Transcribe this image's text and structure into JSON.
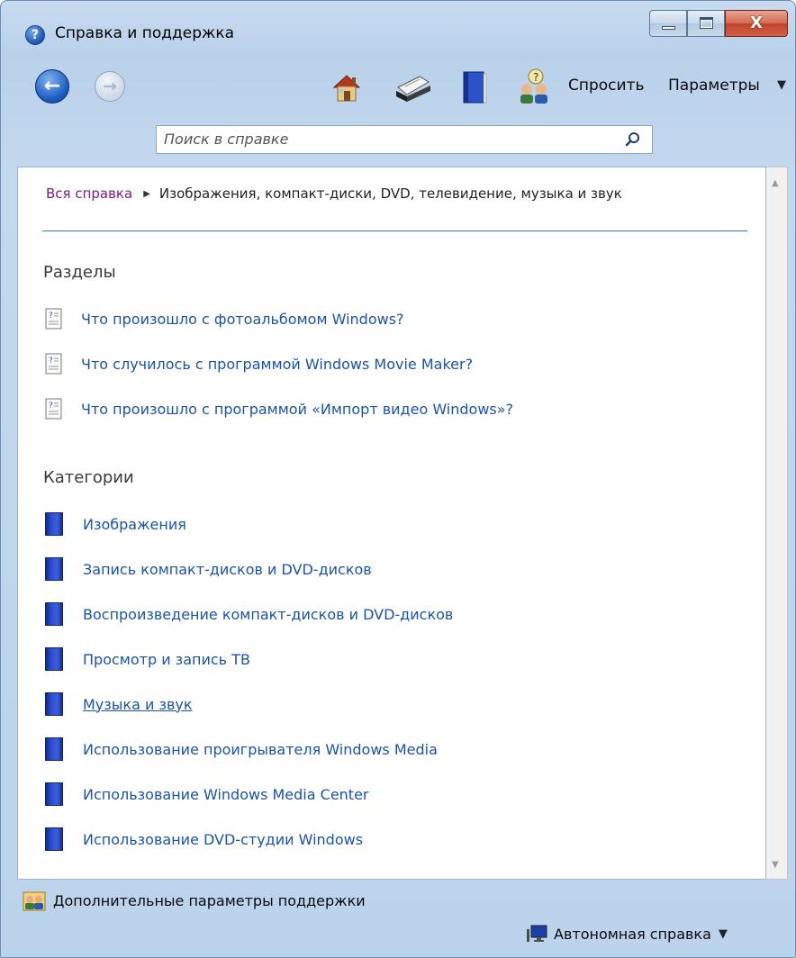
{
  "window": {
    "title": "Справка и поддержка",
    "help_glyph": "?",
    "min_glyph": "",
    "max_glyph": "",
    "close_glyph": "X"
  },
  "toolbar": {
    "back_glyph": "←",
    "forward_glyph": "→",
    "ask_label": "Спросить",
    "params_label": "Параметры",
    "params_arrow": "▼",
    "icons": [
      "home-icon",
      "printer-icon",
      "book-icon",
      "ask-icon"
    ]
  },
  "search": {
    "placeholder": "Поиск в справке",
    "value": ""
  },
  "breadcrumb": {
    "root": "Вся справка",
    "separator": "▶",
    "current": "Изображения, компакт-диски, DVD, телевидение, музыка и звук"
  },
  "sections": {
    "topics_title": "Разделы",
    "topics": [
      "Что произошло с фотоальбомом Windows?",
      "Что случилось с программой Windows Movie Maker?",
      "Что произошло с программой «Импорт видео Windows»?"
    ],
    "categories_title": "Категории",
    "categories": [
      "Изображения",
      "Запись компакт-дисков и DVD-дисков",
      "Воспроизведение компакт-дисков и DVD-дисков",
      "Просмотр и запись ТВ",
      "Музыка и звук",
      "Использование проигрывателя Windows Media",
      "Использование Windows Media Center",
      "Использование DVD-студии Windows"
    ]
  },
  "scroll": {
    "up": "▲",
    "down": "▼"
  },
  "footer": {
    "support": "Дополнительные параметры поддержки",
    "offline": "Автономная справка",
    "offline_arrow": "▼"
  },
  "colors": {
    "link": "#1a53a8",
    "visited_link": "#7a1c86",
    "divider": "#3b74b8",
    "category_icon": "#2f4fd0",
    "frame": "#bcd3ec"
  }
}
